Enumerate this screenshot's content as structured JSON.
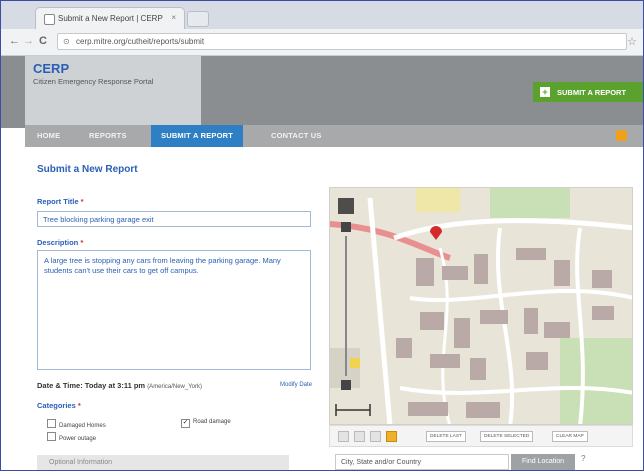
{
  "browser": {
    "tab_title": "Submit a New Report | CERP",
    "tab_close": "×",
    "back": "←",
    "forward": "→",
    "reload": "C",
    "url": "cerp.mitre.org/cutheit/reports/submit"
  },
  "site": {
    "logo_title": "CERP",
    "logo_subtitle": "Citizen Emergency Response Portal",
    "submit_button": "SUBMIT A REPORT"
  },
  "nav": {
    "items": [
      "HOME",
      "REPORTS",
      "SUBMIT A REPORT",
      "CONTACT US"
    ],
    "active": "SUBMIT A REPORT"
  },
  "form": {
    "page_title": "Submit a New Report",
    "report_title_label": "Report Title",
    "report_title_value": "Tree blocking parking garage exit",
    "description_label": "Description",
    "description_value": "A large tree is stopping any cars from leaving the parking garage. Many students can't use their cars to get off campus.",
    "required_mark": "*",
    "datetime_label": "Date & Time: Today at 3:11 pm",
    "timezone": "(America/New_York)",
    "modify_link": "Modify Date",
    "categories_label": "Categories",
    "categories": [
      {
        "label": "Damaged Homes",
        "checked": false
      },
      {
        "label": "Road damage",
        "checked": true
      },
      {
        "label": "Power outage",
        "checked": false
      }
    ],
    "optional_section": "Optional Information"
  },
  "map": {
    "tools": [
      "DELETE LAST",
      "DELETE SELECTED",
      "CLEAR MAP"
    ],
    "location_placeholder": "City, State and/or Country",
    "find_button": "Find Location",
    "scale_label": "",
    "help_icon": "?"
  },
  "colors": {
    "accent": "#2f7fc4",
    "header": "#8b8e91",
    "submit_green": "#5aa12e",
    "marker_red": "#d42a2a"
  }
}
